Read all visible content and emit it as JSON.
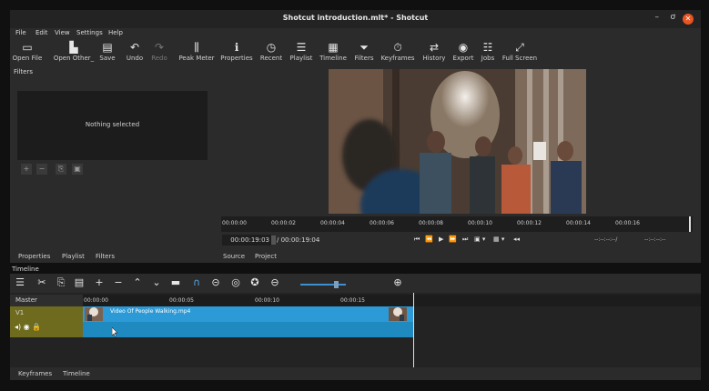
{
  "window": {
    "title": "Shotcut introduction.mlt* - Shotcut",
    "min": "–",
    "max": "ơ",
    "close": "✕"
  },
  "menu": [
    "File",
    "Edit",
    "View",
    "Settings",
    "Help"
  ],
  "toolbar": [
    {
      "label": "Open File",
      "icon": "▭",
      "name": "open-file"
    },
    {
      "label": "Open Other_",
      "icon": "▙",
      "name": "open-other"
    },
    {
      "label": "Save",
      "icon": "▤",
      "name": "save"
    },
    {
      "label": "Undo",
      "icon": "↶",
      "name": "undo"
    },
    {
      "label": "Redo",
      "icon": "↷",
      "name": "redo"
    },
    {
      "label": "Peak Meter",
      "icon": "⫼",
      "name": "peak-meter"
    },
    {
      "label": "Properties",
      "icon": "ℹ",
      "name": "properties"
    },
    {
      "label": "Recent",
      "icon": "◷",
      "name": "recent"
    },
    {
      "label": "Playlist",
      "icon": "☰",
      "name": "playlist"
    },
    {
      "label": "Timeline",
      "icon": "▦",
      "name": "timeline"
    },
    {
      "label": "Filters",
      "icon": "⏷",
      "name": "filters"
    },
    {
      "label": "Keyframes",
      "icon": "⏱",
      "name": "keyframes"
    },
    {
      "label": "History",
      "icon": "⇄",
      "name": "history"
    },
    {
      "label": "Export",
      "icon": "◉",
      "name": "export"
    },
    {
      "label": "Jobs",
      "icon": "☷",
      "name": "jobs"
    },
    {
      "label": "Full Screen",
      "icon": "⤢",
      "name": "full-screen"
    }
  ],
  "filters": {
    "title": "Filters",
    "empty_text": "Nothing selected",
    "buttons": [
      "+",
      "−",
      "⎘",
      "▣"
    ]
  },
  "left_tabs": [
    "Properties",
    "Playlist",
    "Filters"
  ],
  "viewer": {
    "ruler_ticks": [
      "00:00:00",
      "00:00:02",
      "00:00:04",
      "00:00:06",
      "00:00:08",
      "00:00:10",
      "00:00:12",
      "00:00:14",
      "00:00:16"
    ],
    "timecode": "00:00:19:03",
    "total": "/ 00:00:19:04",
    "in_point": "--:--:--:--/",
    "out_point": "--:--:--:--",
    "transport": [
      "⏮",
      "⏪",
      "▶",
      "⏩",
      "⏭",
      "▣ ▾",
      "▦ ▾",
      "◂◂"
    ],
    "tabs": [
      "Source",
      "Project"
    ]
  },
  "timeline": {
    "label": "Timeline",
    "tools": [
      "☰",
      "✂",
      "⎘",
      "▤",
      "+",
      "−",
      "⌃",
      "⌄",
      "▬",
      "∩",
      "⊝",
      "◎",
      "✪",
      "⊖"
    ],
    "zoom_in": "⊕",
    "master": "Master",
    "track": "V1",
    "track_icons": "◂) ◉ 🔒",
    "ruler": [
      "00:00:00",
      "00:00:05",
      "00:00:10",
      "00:00:15"
    ],
    "clip_name": "Video Of People Walking.mp4"
  },
  "bottom_tabs": [
    "Keyframes",
    "Timeline"
  ]
}
